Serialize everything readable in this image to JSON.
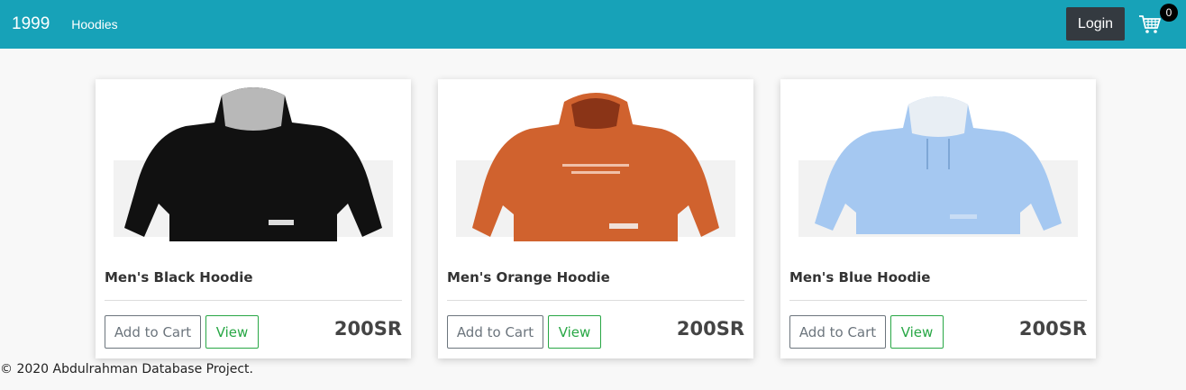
{
  "navbar": {
    "brand": "1999",
    "link": "Hoodies",
    "login_label": "Login",
    "cart_count": "0",
    "bg_color": "#17a2b8"
  },
  "products": [
    {
      "title": "Men's Black Hoodie",
      "price": "200SR",
      "add_label": "Add to Cart",
      "view_label": "View",
      "color": "#111111"
    },
    {
      "title": "Men's Orange Hoodie",
      "price": "200SR",
      "add_label": "Add to Cart",
      "view_label": "View",
      "color": "#d0622e"
    },
    {
      "title": "Men's Blue Hoodie",
      "price": "200SR",
      "add_label": "Add to Cart",
      "view_label": "View",
      "color": "#a5c8f1"
    }
  ],
  "footer": {
    "text": "© 2020 Abdulrahman Database Project."
  }
}
